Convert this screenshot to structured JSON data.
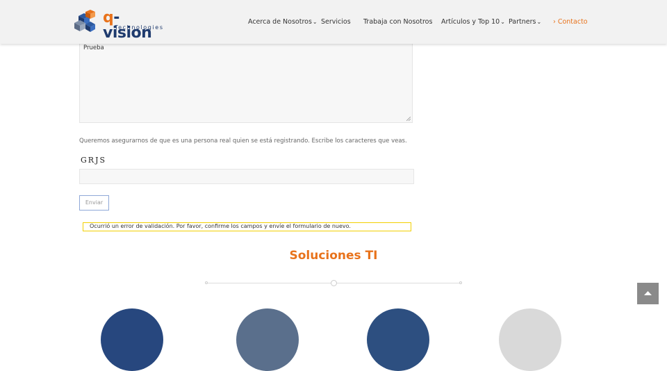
{
  "brand": {
    "name_prefix": "q",
    "name_suffix": "-vision",
    "tagline": "Technologies",
    "colors": {
      "orange": "#e8731c",
      "navy": "#1f3b6e"
    }
  },
  "nav": {
    "items": [
      {
        "label": "Acerca de Nosotros",
        "has_dropdown": true
      },
      {
        "label": "Servicios",
        "has_dropdown": false
      },
      {
        "label": "Trabaja con Nosotros",
        "has_dropdown": false
      },
      {
        "label": "Artículos y Top 10",
        "has_dropdown": true
      },
      {
        "label": "Partners",
        "has_dropdown": true
      },
      {
        "label": "Contacto",
        "has_dropdown": false,
        "active": true
      }
    ],
    "active_marker": "›"
  },
  "form": {
    "message_value": "Prueba",
    "captcha_note": "Queremos asegurarnos de que es una persona real quien se está registrando. Escribe los caracteres que veas.",
    "captcha_chars": "GRJS",
    "captcha_value": "",
    "submit_label": "Enviar",
    "error_message": "Ocurrió un error de validación. Por favor, confirme los campos y envíe el formulario de nuevo."
  },
  "section": {
    "title": "Soluciones TI"
  }
}
